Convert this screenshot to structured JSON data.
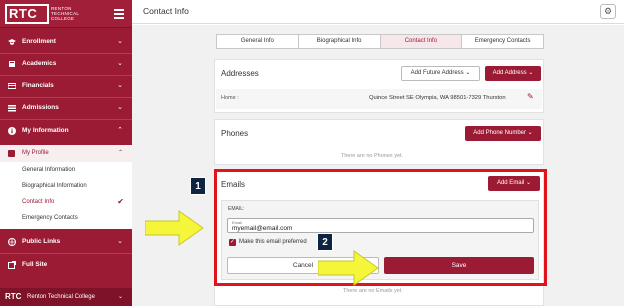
{
  "sidebar": {
    "logo_text": "RTC",
    "logo_sub": [
      "RENTON",
      "TECHNICAL",
      "COLLEGE"
    ],
    "items": [
      {
        "label": "Enrollment",
        "icon": "graduation-cap-icon"
      },
      {
        "label": "Academics",
        "icon": "book-icon"
      },
      {
        "label": "Financials",
        "icon": "credit-card-icon"
      },
      {
        "label": "Admissions",
        "icon": "stack-icon"
      },
      {
        "label": "My Information",
        "icon": "info-icon"
      }
    ],
    "profile": {
      "label": "My Profile",
      "subitems": [
        "General Information",
        "Biographical Information",
        "Contact Info",
        "Emergency Contacts"
      ],
      "active": "Contact Info"
    },
    "items_after": [
      {
        "label": "Public Links",
        "icon": "globe-icon"
      },
      {
        "label": "Full Site",
        "icon": "external-link-icon"
      }
    ],
    "footer": {
      "logo": "RTC",
      "name": "Renton Technical College"
    }
  },
  "header": {
    "title": "Contact Info"
  },
  "tabs": [
    "General Info",
    "Biographical Info",
    "Contact Info",
    "Emergency Contacts"
  ],
  "active_tab": "Contact Info",
  "addresses": {
    "title": "Addresses",
    "add_future_label": "Add Future Address",
    "add_label": "Add Address",
    "row_type": "Home :",
    "row_value": "Quince Street SE Olympia, WA 98501-7329 Thurston"
  },
  "phones": {
    "title": "Phones",
    "add_label": "Add Phone Number",
    "empty": "There are no Phones yet."
  },
  "emails": {
    "title": "Emails",
    "add_label": "Add Email",
    "section_label": "EMAIL:",
    "field_label": "Email",
    "field_value": "myemail@email.com",
    "preferred_label": "Make this email preferred",
    "cancel_label": "Cancel",
    "save_label": "Save",
    "empty": "There are no Emails yet."
  },
  "callouts": {
    "step1": "1",
    "step2": "2"
  },
  "colors": {
    "brand": "#9a1b33",
    "highlight": "#e0141d",
    "arrow": "#f5f53a",
    "badge": "#0e2441"
  }
}
